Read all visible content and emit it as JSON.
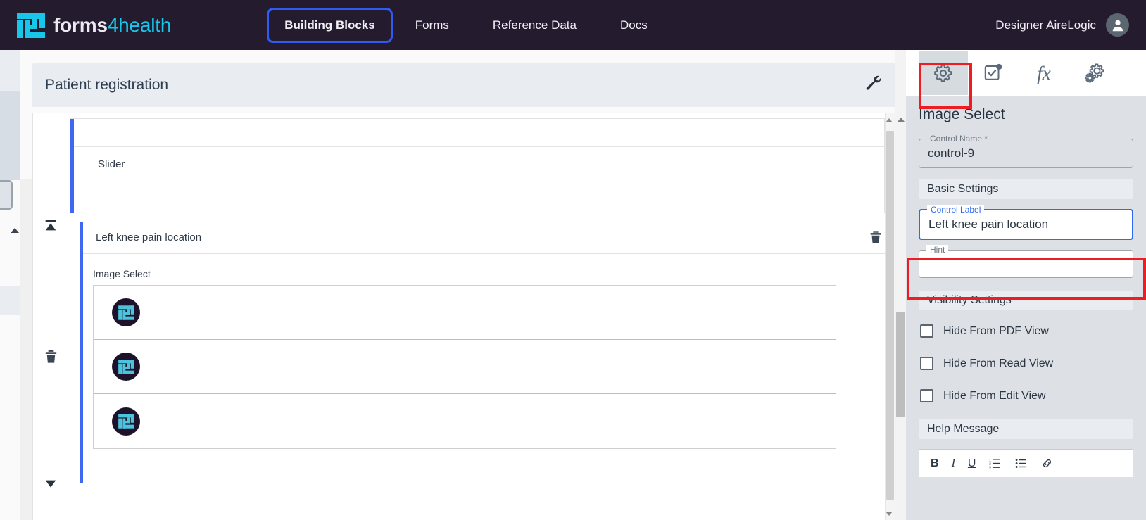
{
  "nav": {
    "brand_word": "forms",
    "brand_accent": "4health",
    "links": [
      {
        "label": "Building Blocks",
        "active": true
      },
      {
        "label": "Forms",
        "active": false
      },
      {
        "label": "Reference Data",
        "active": false
      },
      {
        "label": "Docs",
        "active": false
      }
    ],
    "user_name": "Designer AireLogic",
    "avatar_icon": "user-avatar-icon"
  },
  "form": {
    "title": "Patient registration",
    "tools_icon": "wrench-icon"
  },
  "canvas": {
    "blocks": [
      {
        "label": "",
        "control_type": "Slider",
        "selected": false
      },
      {
        "label": "Left knee pain location",
        "control_type": "Image Select",
        "selected": true,
        "delete_icon": "trash-icon",
        "images": [
          "forms4health-logo-thumb",
          "forms4health-logo-thumb",
          "forms4health-logo-thumb"
        ]
      }
    ],
    "gutter_icons": [
      "move-to-top-icon",
      "delete-icon",
      "move-to-bottom-icon"
    ]
  },
  "right_panel": {
    "icon_bar": [
      {
        "name": "settings-gear-icon",
        "glyph": "gear",
        "selected": true,
        "highlighted": true
      },
      {
        "name": "validation-checkbox-icon",
        "glyph": "checkbox-dot",
        "selected": false,
        "highlighted": false
      },
      {
        "name": "expression-fx-icon",
        "glyph": "fx",
        "label": "fx",
        "selected": false,
        "highlighted": false
      },
      {
        "name": "advanced-settings-icon",
        "glyph": "double-gear",
        "selected": false,
        "highlighted": false
      }
    ],
    "title": "Image Select",
    "control_name": {
      "legend": "Control Name *",
      "value": "control-9"
    },
    "basic_settings_header": "Basic Settings",
    "control_label": {
      "legend": "Control Label",
      "value": "Left knee pain location",
      "focused": true,
      "highlighted": true
    },
    "hint": {
      "legend": "Hint",
      "value": ""
    },
    "visibility_settings_header": "Visibility Settings",
    "visibility_options": [
      {
        "label": "Hide From PDF View",
        "checked": false
      },
      {
        "label": "Hide From Read View",
        "checked": false
      },
      {
        "label": "Hide From Edit View",
        "checked": false
      }
    ],
    "help_message_header": "Help Message",
    "editor_toolbar": [
      {
        "name": "bold-icon",
        "label": "B"
      },
      {
        "name": "italic-icon",
        "label": "I"
      },
      {
        "name": "underline-icon",
        "label": "U"
      },
      {
        "name": "numbered-list-icon",
        "label": ""
      },
      {
        "name": "bullet-list-icon",
        "label": ""
      },
      {
        "name": "link-icon",
        "label": ""
      }
    ]
  },
  "colors": {
    "nav_bg": "#241b2f",
    "brand_cyan": "#17c7ea",
    "accent_blue": "#3f68f2",
    "focus_blue": "#2f6bf0",
    "highlight_red": "#ee1c23",
    "panel_bg": "#dde1e6"
  }
}
